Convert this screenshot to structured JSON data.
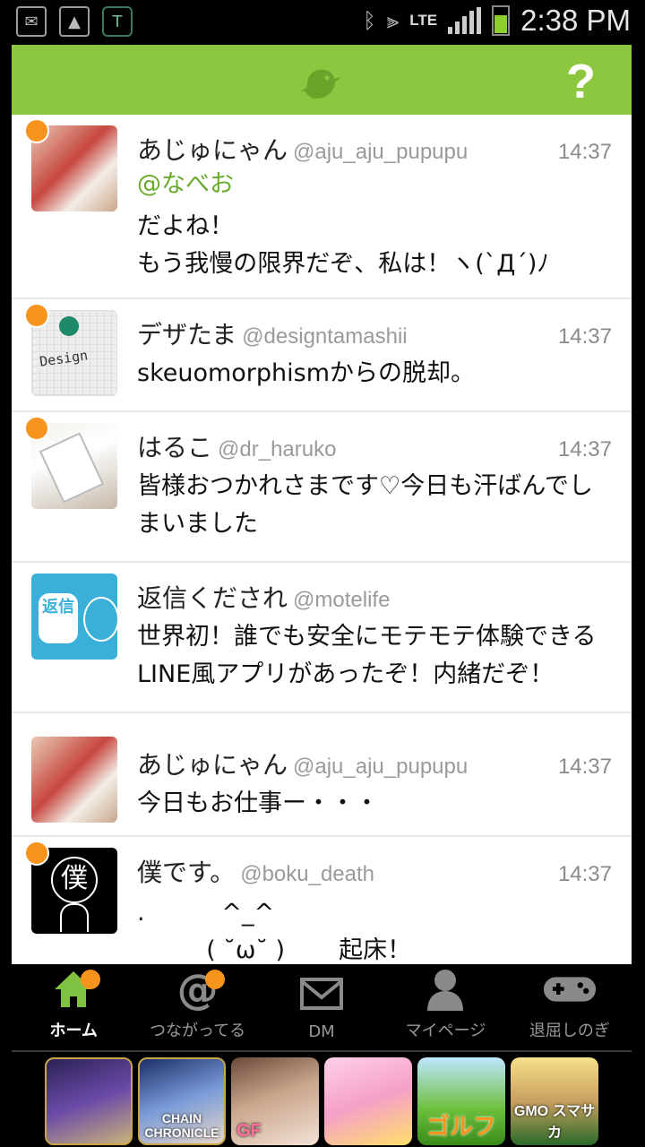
{
  "status_bar": {
    "time": "2:38 PM",
    "network": "LTE",
    "left_icons": [
      "mail-icon",
      "gallery-icon",
      "t-app-icon"
    ],
    "right_icons": [
      "bluetooth-icon",
      "vibrate-icon",
      "signal-icon",
      "battery-icon"
    ]
  },
  "header": {
    "logo": "bird-icon",
    "help_label": "?",
    "color": "#8dc63f"
  },
  "posts": [
    {
      "name": "あじゅにゃん",
      "handle": "@aju_aju_pupupu",
      "time": "14:37",
      "mention": "@なべお",
      "text": "だよね！\nもう我慢の限界だぞ、私は！ヽ(`Д´)ﾉ",
      "unread": true
    },
    {
      "name": "デザたま",
      "handle": "@designtamashii",
      "time": "14:37",
      "text": "skeuomorphismからの脱却。",
      "avatar_label": "Design",
      "unread": true
    },
    {
      "name": "はるこ",
      "handle": "@dr_haruko",
      "time": "14:37",
      "text": "皆様おつかれさまです♡今日も汗ばんでしまいました",
      "unread": true
    },
    {
      "name": "返信くだされ",
      "handle": "@motelife",
      "time": "",
      "text": "世界初！誰でも安全にモテモテ体験できるLINE風アプリがあったぞ！内緒だぞ！",
      "avatar_label": "返信",
      "unread": false
    },
    {
      "name": "あじゅにゃん",
      "handle": "@aju_aju_pupupu",
      "time": "14:37",
      "text": "今日もお仕事ー・・・",
      "unread": false
    },
    {
      "name": "僕です。",
      "handle": "@boku_death",
      "time": "14:37",
      "text": ".          ^_^\n         ( ˘ω˘ )       起床！",
      "avatar_label": "僕",
      "unread": true
    }
  ],
  "tabs": [
    {
      "label": "ホーム",
      "icon": "home-icon",
      "active": true,
      "badge": true
    },
    {
      "label": "つながってる",
      "icon": "mention-icon",
      "active": false,
      "badge": true
    },
    {
      "label": "DM",
      "icon": "mail-icon",
      "active": false,
      "badge": false
    },
    {
      "label": "マイページ",
      "icon": "person-icon",
      "active": false,
      "badge": false
    },
    {
      "label": "退屈しのぎ",
      "icon": "gamepad-icon",
      "active": false,
      "badge": false
    }
  ],
  "ads": [
    {
      "icon": "game-ad-warrior-icon",
      "text": "",
      "color": "#5a3d8a"
    },
    {
      "icon": "game-ad-chain-chronicle-icon",
      "text": "CHAIN CHRONICLE",
      "color": "#2a4a8a"
    },
    {
      "icon": "game-ad-gf-icon",
      "text": "GF",
      "color": "#c9a58c"
    },
    {
      "icon": "game-ad-doll-icon",
      "text": "",
      "color": "#f5a0c8"
    },
    {
      "icon": "game-ad-golf-icon",
      "text": "ゴルフ",
      "color": "#6bbf3a"
    },
    {
      "icon": "game-ad-soccer-icon",
      "text": "GMO スマサカ",
      "color": "#c8a060"
    }
  ]
}
